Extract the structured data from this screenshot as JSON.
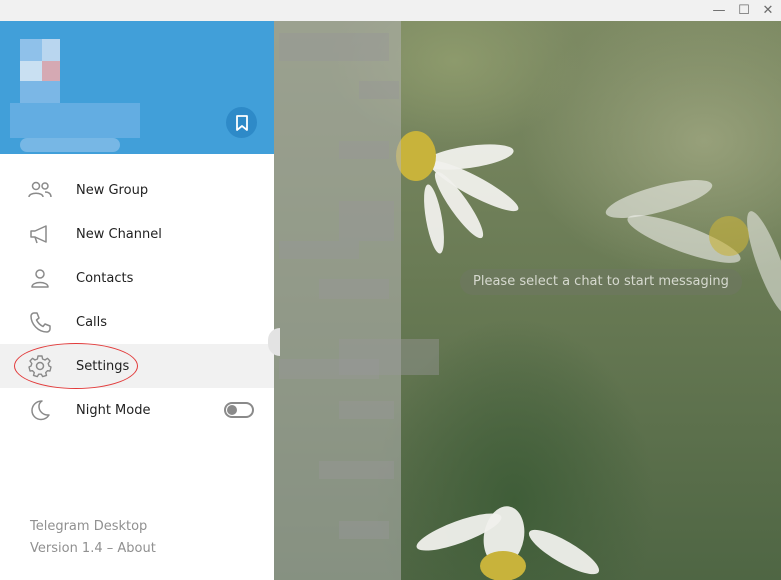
{
  "window": {
    "controls": {
      "minimize": "—",
      "maximize": "☐",
      "close": "✕"
    }
  },
  "main": {
    "empty_message": "Please select a chat to start messaging"
  },
  "sidebar": {
    "header_color": "#419fd9",
    "items": [
      {
        "label": "New Group",
        "icon": "new-group-icon"
      },
      {
        "label": "New Channel",
        "icon": "new-channel-icon"
      },
      {
        "label": "Contacts",
        "icon": "contacts-icon"
      },
      {
        "label": "Calls",
        "icon": "calls-icon"
      },
      {
        "label": "Settings",
        "icon": "settings-icon"
      },
      {
        "label": "Night Mode",
        "icon": "night-mode-icon"
      }
    ],
    "night_mode_on": false,
    "footer_app": "Telegram Desktop",
    "footer_version": "Version 1.4 – About"
  }
}
